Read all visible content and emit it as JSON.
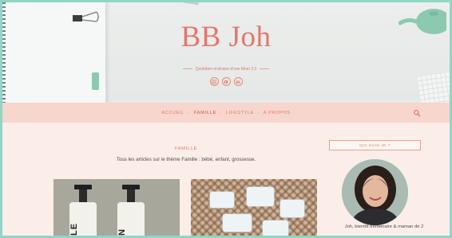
{
  "site": {
    "title": "BB Joh",
    "tagline": "Quotidien ordinaire d'une Mom 2.0",
    "socials": [
      "instagram-icon",
      "pinterest-icon",
      "email-icon"
    ]
  },
  "nav": {
    "items": [
      {
        "label": "ACCUEIL",
        "active": false
      },
      {
        "label": "FAMILLE",
        "active": true
      },
      {
        "label": "LIFESTYLE",
        "active": false
      },
      {
        "label": "A PROPOS",
        "active": false
      }
    ],
    "separator": "•",
    "search_icon": "search-icon"
  },
  "category": {
    "title": "FAMILLE",
    "description": "Tous les articles sur le thème Famille : bébé, enfant, grossesse."
  },
  "posts": [
    {
      "image": "post-image-bottles",
      "bottle_labels": [
        "LE",
        "N"
      ]
    },
    {
      "image": "post-image-basket"
    }
  ],
  "sidebar": {
    "widget_title": "QUI SUIS-JE ?",
    "bio": "Joh, bientôt trentenaire & maman de 2"
  },
  "colors": {
    "accent": "#e0786c",
    "nav_bg": "#f6d6cd",
    "page_bg": "#fbeee9",
    "frame": "#8fd6c6"
  }
}
